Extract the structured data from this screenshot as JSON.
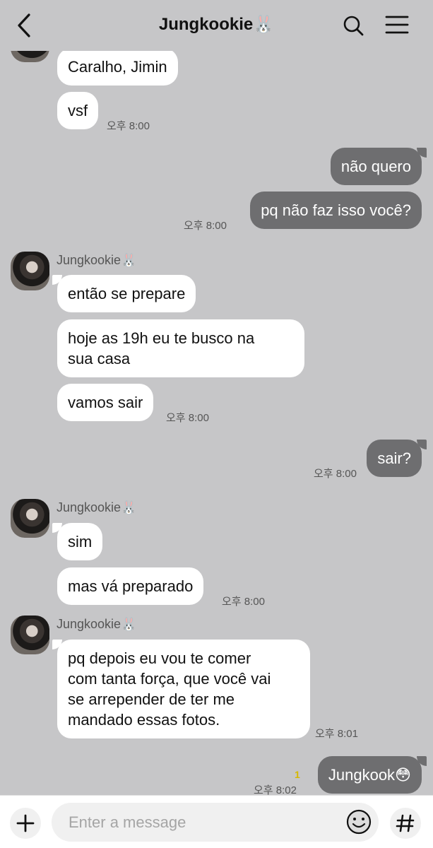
{
  "header": {
    "title": "Jungkookie🐰",
    "back_icon": "chevron-left-icon",
    "search_icon": "search-icon",
    "menu_icon": "hamburger-menu-icon"
  },
  "messages": [
    {
      "text": "Caralho, Jimin"
    },
    {
      "text": "vsf",
      "time": "오후 8:00"
    },
    {
      "text": "não quero"
    },
    {
      "text": "pq não faz isso você?",
      "time": "오후 8:00"
    },
    {
      "sender": "Jungkookie🐰"
    },
    {
      "text": "então se prepare"
    },
    {
      "text": "hoje as 19h eu te busco na\nsua casa"
    },
    {
      "text": "vamos sair",
      "time": "오후 8:00"
    },
    {
      "text": "sair?",
      "time": "오후 8:00"
    },
    {
      "sender": "Jungkookie🐰"
    },
    {
      "text": "sim"
    },
    {
      "text": "mas vá preparado",
      "time": "오후 8:00"
    },
    {
      "sender": "Jungkookie🐰"
    },
    {
      "text": "pq depois eu vou te comer\ncom tanta força, que você vai\nse arrepender de ter me\nmandado essas fotos.",
      "time": "오후 8:01"
    },
    {
      "text": "Jungkook😳",
      "time": "오후 8:02",
      "unread": "1"
    }
  ],
  "composer": {
    "placeholder": "Enter a message",
    "value": "",
    "plus_icon": "plus-icon",
    "emoji_icon": "emoji-icon",
    "hash_icon": "hashtag-icon"
  }
}
